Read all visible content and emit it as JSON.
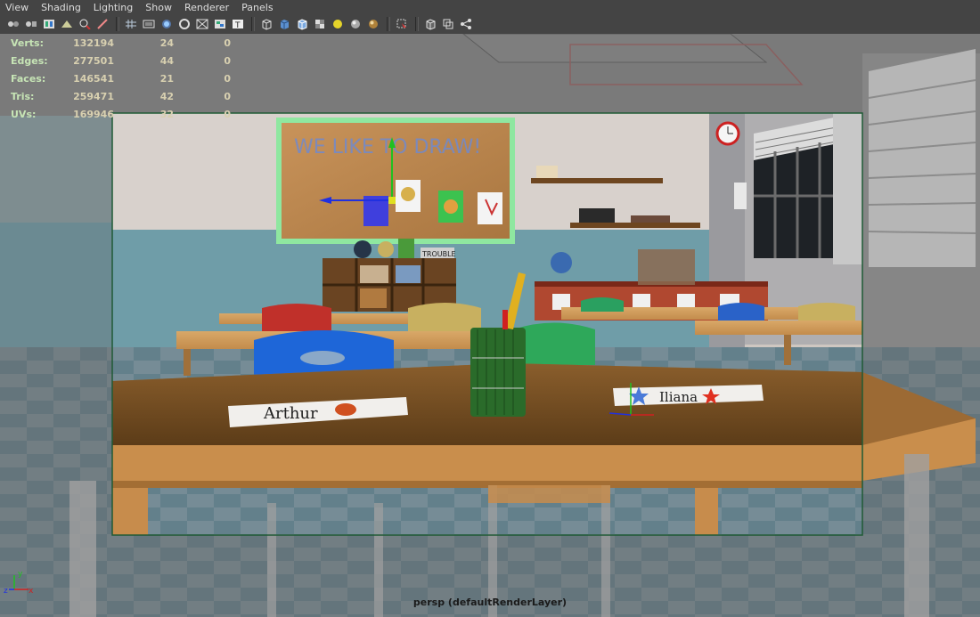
{
  "menu": [
    "View",
    "Shading",
    "Lighting",
    "Show",
    "Renderer",
    "Panels"
  ],
  "toolbar_icons": [
    "select-camera-icon",
    "camera-attributes-icon",
    "bookmarks-icon",
    "image-plane-icon",
    "two-d-pan-zoom-icon",
    "grease-pencil-icon",
    "grid-icon",
    "film-gate-icon",
    "resolution-gate-icon",
    "gate-mask-icon",
    "field-chart-icon",
    "safe-action-icon",
    "safe-title-icon",
    "wireframe-icon",
    "smooth-shade-icon",
    "wireframe-on-shaded-icon",
    "textured-icon",
    "use-all-lights-icon",
    "shadows-icon",
    "ambient-occlusion-icon",
    "isolate-select-icon",
    "xray-icon",
    "xray-joints-icon",
    "xray-components-icon"
  ],
  "hud": {
    "rows": [
      {
        "label": "Verts:",
        "v1": "132194",
        "v2": "24",
        "v3": "0"
      },
      {
        "label": "Edges:",
        "v1": "277501",
        "v2": "44",
        "v3": "0"
      },
      {
        "label": "Faces:",
        "v1": "146541",
        "v2": "21",
        "v3": "0"
      },
      {
        "label": "Tris:",
        "v1": "259471",
        "v2": "42",
        "v3": "0"
      },
      {
        "label": "UVs:",
        "v1": "169946",
        "v2": "32",
        "v3": "0"
      }
    ]
  },
  "scene": {
    "board_text": "WE LIKE TO DRAW!",
    "trouble_text": "TROUBLE",
    "name_card_left": "Arthur",
    "name_card_right": "Iliana"
  },
  "camera_label": "persp (defaultRenderLayer)",
  "axis": {
    "x": "x",
    "y": "y",
    "z": "z"
  }
}
